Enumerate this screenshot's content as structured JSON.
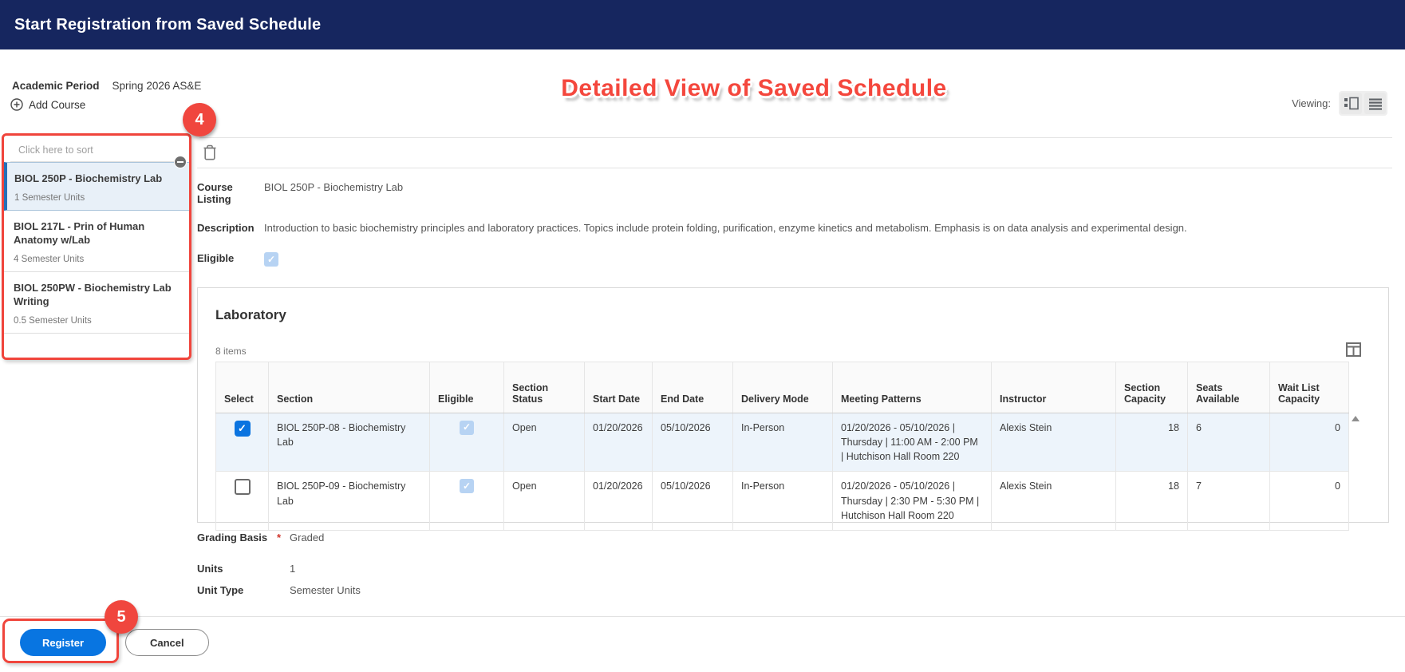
{
  "header": {
    "title": "Start Registration from Saved Schedule"
  },
  "toolbar": {
    "academic_period_label": "Academic Period",
    "academic_period_value": "Spring 2026 AS&E",
    "add_course_label": "Add Course",
    "viewing_label": "Viewing:"
  },
  "annotations": {
    "heading": "Detailed View of Saved Schedule",
    "step_4": "4",
    "step_5": "5"
  },
  "course_list": {
    "sort_placeholder": "Click here to sort",
    "items": [
      {
        "title": "BIOL 250P - Biochemistry Lab",
        "units": "1 Semester Units",
        "selected": true
      },
      {
        "title": "BIOL 217L - Prin of Human Anatomy w/Lab",
        "units": "4 Semester Units",
        "selected": false
      },
      {
        "title": "BIOL 250PW - Biochemistry Lab Writing",
        "units": "0.5 Semester Units",
        "selected": false
      }
    ]
  },
  "detail": {
    "course_listing_label": "Course Listing",
    "course_listing_value": "BIOL 250P - Biochemistry Lab",
    "description_label": "Description",
    "description_value": "Introduction to basic biochemistry principles and laboratory practices.  Topics include protein folding, purification, enzyme kinetics and metabolism.  Emphasis is on data analysis and experimental design.",
    "eligible_label": "Eligible",
    "eligible_checked": true
  },
  "laboratory": {
    "title": "Laboratory",
    "items_count": "8 items",
    "columns": [
      "Select",
      "Section",
      "Eligible",
      "Section Status",
      "Start Date",
      "End Date",
      "Delivery Mode",
      "Meeting Patterns",
      "Instructor",
      "Section Capacity",
      "Seats Available",
      "Wait List Capacity"
    ],
    "rows": [
      {
        "selected": true,
        "section": "BIOL 250P-08 - Biochemistry Lab",
        "eligible": true,
        "status": "Open",
        "start_date": "01/20/2026",
        "end_date": "05/10/2026",
        "delivery_mode": "In-Person",
        "meeting_patterns": "01/20/2026 - 05/10/2026 | Thursday | 11:00 AM - 2:00 PM | Hutchison Hall Room 220",
        "instructor": "Alexis Stein",
        "section_capacity": "18",
        "seats_available": "6",
        "wait_list_capacity": "0"
      },
      {
        "selected": false,
        "section": "BIOL 250P-09 - Biochemistry Lab",
        "eligible": true,
        "status": "Open",
        "start_date": "01/20/2026",
        "end_date": "05/10/2026",
        "delivery_mode": "In-Person",
        "meeting_patterns": "01/20/2026 - 05/10/2026 | Thursday | 2:30 PM - 5:30 PM | Hutchison Hall Room 220",
        "instructor": "Alexis Stein",
        "section_capacity": "18",
        "seats_available": "7",
        "wait_list_capacity": "0"
      }
    ]
  },
  "summary": {
    "grading_basis_label": "Grading Basis",
    "required_marker": "*",
    "grading_basis_value": "Graded",
    "units_label": "Units",
    "units_value": "1",
    "unit_type_label": "Unit Type",
    "unit_type_value": "Semester Units"
  },
  "footer": {
    "register_label": "Register",
    "cancel_label": "Cancel"
  },
  "colors": {
    "header_navy": "#16265f",
    "annotation_red": "#f0453c",
    "accent_blue": "#0875e1",
    "selected_row_bg": "#edf4fb",
    "disabled_checkbox_blue": "#b7d3f3",
    "selected_course_bg": "#e8f0f8"
  }
}
